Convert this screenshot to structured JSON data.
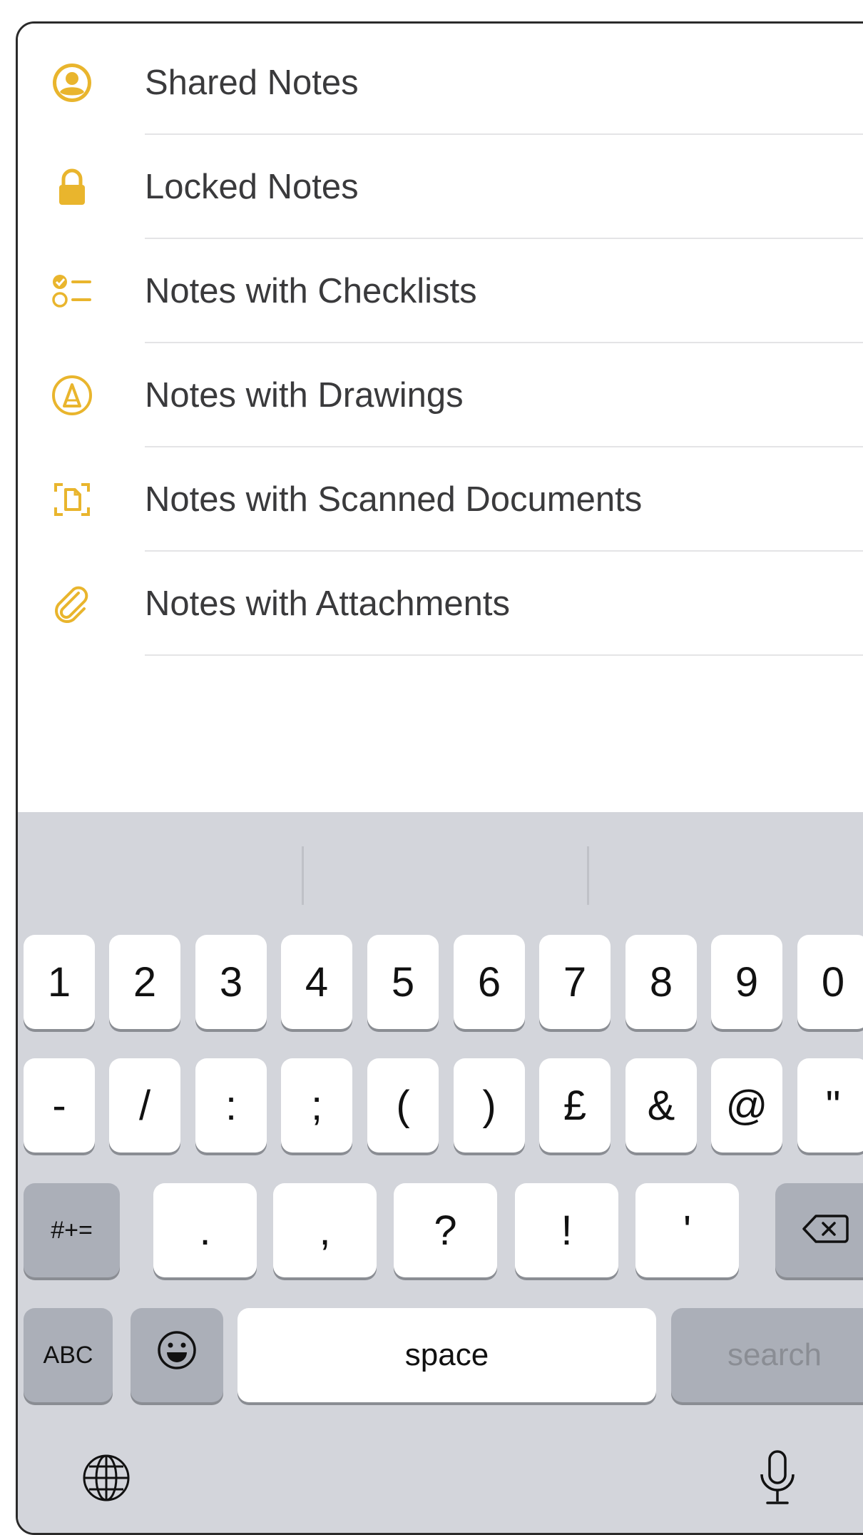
{
  "list": {
    "items": [
      {
        "label": "Shared Notes",
        "icon": "person-circle-icon"
      },
      {
        "label": "Locked Notes",
        "icon": "lock-icon"
      },
      {
        "label": "Notes with Checklists",
        "icon": "checklist-icon"
      },
      {
        "label": "Notes with Drawings",
        "icon": "pen-circle-icon"
      },
      {
        "label": "Notes with Scanned Documents",
        "icon": "document-scanner-icon"
      },
      {
        "label": "Notes with Attachments",
        "icon": "paperclip-icon"
      }
    ],
    "accent_color": "#e9b52d"
  },
  "keyboard": {
    "row1": [
      "1",
      "2",
      "3",
      "4",
      "5",
      "6",
      "7",
      "8",
      "9",
      "0"
    ],
    "row2": [
      "-",
      "/",
      ":",
      ";",
      "(",
      ")",
      "£",
      "&",
      "@",
      "\""
    ],
    "row3": {
      "shift_label": "#+=",
      "keys": [
        ".",
        ",",
        "?",
        "!",
        "'"
      ],
      "delete_icon": "delete-backspace-icon"
    },
    "row4": {
      "abc_label": "ABC",
      "emoji_icon": "emoji-icon",
      "space_label": "space",
      "search_label": "search"
    },
    "bottom": {
      "globe_icon": "globe-icon",
      "mic_icon": "microphone-icon"
    }
  }
}
